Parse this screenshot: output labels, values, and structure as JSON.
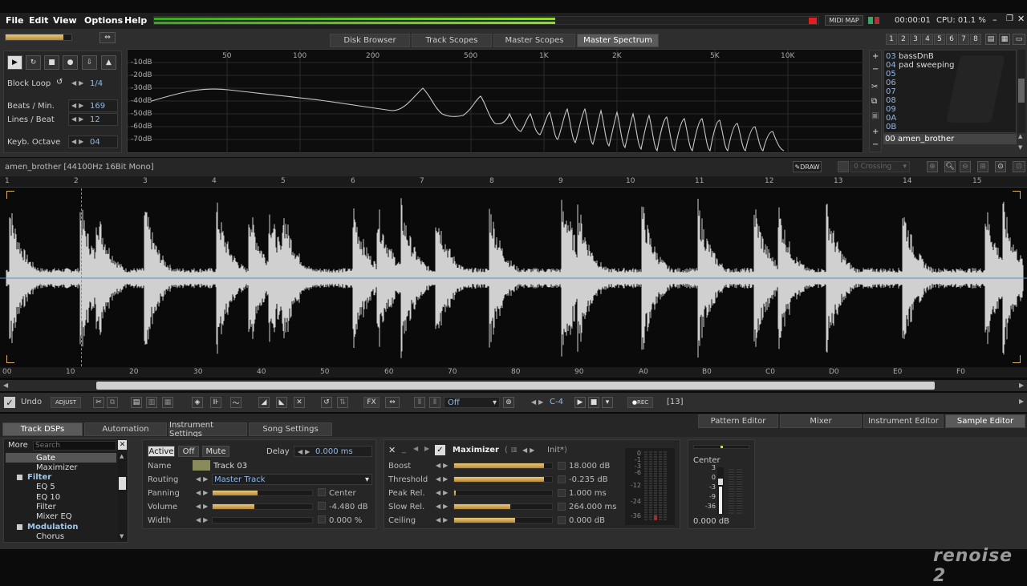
{
  "menu": {
    "file": "File",
    "edit": "Edit",
    "view": "View",
    "options": "Options",
    "help": "Help"
  },
  "topbar": {
    "midi_map": "MIDI MAP",
    "time": "00:00:01",
    "cpu": "CPU: 01.1 %"
  },
  "upper_tabs": [
    "Disk Browser",
    "Track Scopes",
    "Master Scopes",
    "Master Spectrum"
  ],
  "transport": {
    "block_loop_label": "Block Loop",
    "block_loop_value": "1/4",
    "bpm_label": "Beats / Min.",
    "bpm_value": "169",
    "lpb_label": "Lines / Beat",
    "lpb_value": "12",
    "octave_label": "Keyb. Octave",
    "octave_value": "04"
  },
  "spectrum": {
    "db_labels": [
      "-10dB",
      "-20dB",
      "-30dB",
      "-40dB",
      "-50dB",
      "-60dB",
      "-70dB"
    ],
    "freq_labels": [
      "50",
      "100",
      "200",
      "500",
      "1K",
      "2K",
      "5K",
      "10K"
    ]
  },
  "pattern_numbers": [
    "1",
    "2",
    "3",
    "4",
    "5",
    "6",
    "7",
    "8"
  ],
  "instruments": [
    {
      "num": "03",
      "name": "bassDnB"
    },
    {
      "num": "04",
      "name": "pad sweeping"
    },
    {
      "num": "05",
      "name": ""
    },
    {
      "num": "06",
      "name": ""
    },
    {
      "num": "07",
      "name": ""
    },
    {
      "num": "08",
      "name": ""
    },
    {
      "num": "09",
      "name": ""
    },
    {
      "num": "0A",
      "name": ""
    },
    {
      "num": "0B",
      "name": ""
    }
  ],
  "selected_instrument": {
    "num": "00",
    "name": "amen_brother"
  },
  "sample": {
    "info": "amen_brother [44100Hz 16Bit Mono]",
    "draw_label": "DRAW",
    "zero_crossing_label": "0 Crossing",
    "top_ruler": [
      "1",
      "2",
      "3",
      "4",
      "5",
      "6",
      "7",
      "8",
      "9",
      "10",
      "11",
      "12",
      "13",
      "14",
      "15"
    ],
    "bottom_ruler": [
      "00",
      "10",
      "20",
      "30",
      "40",
      "50",
      "60",
      "70",
      "80",
      "90",
      "A0",
      "B0",
      "C0",
      "D0",
      "E0",
      "F0"
    ]
  },
  "edit_toolbar": {
    "undo": "Undo",
    "adjust": "ADJUST",
    "fx": "FX",
    "loop_mode": "Off",
    "note": "C-4",
    "rec": "REC",
    "count": "[13]"
  },
  "lower_tabs_left": [
    "Track DSPs",
    "Automation",
    "Instrument Settings",
    "Song Settings"
  ],
  "lower_tabs_right": [
    "Pattern Editor",
    "Mixer",
    "Instrument Editor",
    "Sample Editor"
  ],
  "dsp_browser": {
    "more": "More",
    "search_placeholder": "Search",
    "items": [
      {
        "label": "Gate",
        "level": 2,
        "selected": true
      },
      {
        "label": "Maximizer",
        "level": 2
      },
      {
        "label": "Filter",
        "level": 1
      },
      {
        "label": "EQ 5",
        "level": 2
      },
      {
        "label": "EQ 10",
        "level": 2
      },
      {
        "label": "Filter",
        "level": 2
      },
      {
        "label": "Mixer EQ",
        "level": 2
      },
      {
        "label": "Modulation",
        "level": 1
      },
      {
        "label": "Chorus",
        "level": 2
      }
    ]
  },
  "track_device": {
    "active": "Active",
    "off": "Off",
    "mute": "Mute",
    "delay_label": "Delay",
    "delay_value": "0.000 ms",
    "name_label": "Name",
    "name_value": "Track 03",
    "routing_label": "Routing",
    "routing_value": "Master Track",
    "panning_label": "Panning",
    "panning_value": "Center",
    "panning_level": 0.45,
    "volume_label": "Volume",
    "volume_value": "-4.480 dB",
    "volume_level": 0.42,
    "width_label": "Width",
    "width_value": "0.000 %",
    "width_level": 0.0
  },
  "maximizer": {
    "title": "Maximizer",
    "preset": "Init*",
    "params": [
      {
        "label": "Boost",
        "value": "18.000 dB",
        "level": 0.92
      },
      {
        "label": "Threshold",
        "value": "-0.235 dB",
        "level": 0.92
      },
      {
        "label": "Peak Rel.",
        "value": "1.000 ms",
        "level": 0.02
      },
      {
        "label": "Slow Rel.",
        "value": "264.000 ms",
        "level": 0.57
      },
      {
        "label": "Ceiling",
        "value": "0.000 dB",
        "level": 0.62
      }
    ],
    "meter_scale": [
      "0",
      "-1",
      "-3",
      "-6",
      "-12",
      "-24",
      "-36"
    ]
  },
  "output": {
    "center": "Center",
    "scale": [
      "3",
      "0",
      "-3",
      "-9",
      "-36"
    ],
    "value": "0.000 dB"
  },
  "logo": "renoise 2",
  "colors": {
    "accent_blue": "#8fb8e8",
    "slider_gold": "#d8b060",
    "meter_green": "#7ad030"
  }
}
